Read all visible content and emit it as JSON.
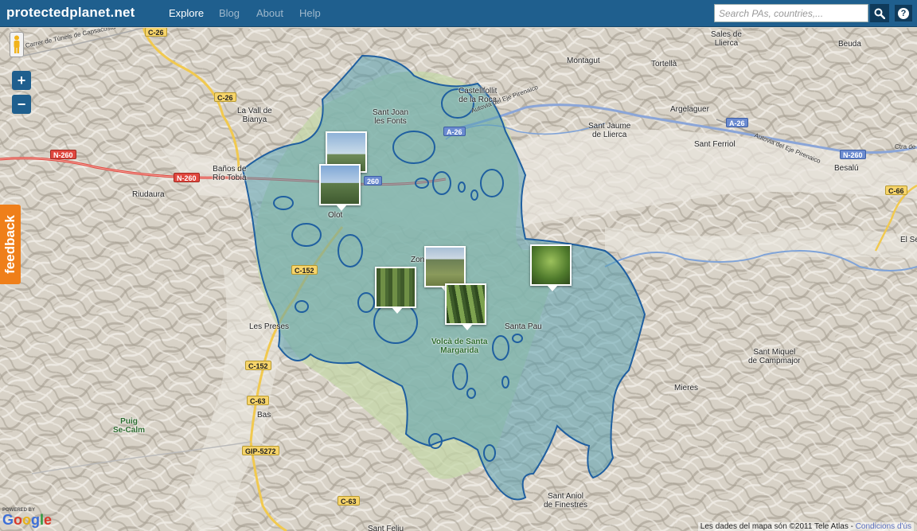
{
  "header": {
    "logo": "protectedplanet.net",
    "nav": [
      {
        "label": "Explore",
        "active": true
      },
      {
        "label": "Blog",
        "active": false
      },
      {
        "label": "About",
        "active": false
      },
      {
        "label": "Help",
        "active": false
      }
    ],
    "search_placeholder": "Search PAs, countries,...",
    "search_icon": "magnifier-icon",
    "help_icon": "question-icon"
  },
  "map": {
    "controls": {
      "zoom_in": "+",
      "zoom_out": "−",
      "pegman_icon": "street-view-pegman-icon"
    },
    "feedback_label": "feedback",
    "place_labels": {
      "sales": "Sales de\nLlierca",
      "beuda": "Beuda",
      "montagut": "Montagut",
      "tortella": "Tortellà",
      "castellfollit": "Castellfollit\nde la Roca",
      "santjoan": "Sant Joan\nles Fonts",
      "argelaguer": "Argelaguer",
      "valldebianya": "La Vall de\nBianya",
      "santjaume": "Sant Jaume\nde Llierca",
      "santferriol": "Sant Ferriol",
      "besalu": "Besalú",
      "banyos": "Baños de\nRío Tobía",
      "riudaura": "Riudaura",
      "olot": "Olot",
      "lespreses": "Les Preses",
      "santapau": "Santa Pau",
      "santmiquel": "Sant Miquel\nde Campmajor",
      "mieres": "Mieres",
      "bas": "Bas",
      "santaniol": "Sant Aniol\nde Finestres",
      "santfeliu": "Sant Feliu",
      "elses": "El Se"
    },
    "park_labels": {
      "puig": "Puig\nSe-Calm",
      "volca": "Volcà de Santa\nMargarida",
      "zona": "Zon"
    },
    "road_shields": {
      "c26a": "C-26",
      "c26b": "C-26",
      "n260a": "N-260",
      "n260b": "N-260",
      "n260c": "N-260",
      "n260d": "260",
      "a26a": "A-26",
      "a26b": "A-26",
      "c66": "C-66",
      "c152a": "C-152",
      "c152b": "C-152",
      "c63a": "C-63",
      "c63b": "C-63",
      "gip": "GIP-5272"
    },
    "road_names": {
      "carrer": "Carrer de Túnels de Capsacosta",
      "autovia1": "Autovia del Eje Pirenaico",
      "autovia2": "Autovia del Eje Pirenaico",
      "ctra": "Ctra de"
    },
    "attribution": "Les dades del mapa són ©2011 Tele Atlas -",
    "attribution_link": "Condicions d'ús",
    "powered_by": "POWERED BY",
    "google": "Google"
  },
  "colors": {
    "header_bg": "#1f5f8e",
    "protected_area_fill": "#5aa0b0",
    "protected_area_stroke": "#1f5fa0",
    "feedback_tab": "#ef7f1a"
  }
}
